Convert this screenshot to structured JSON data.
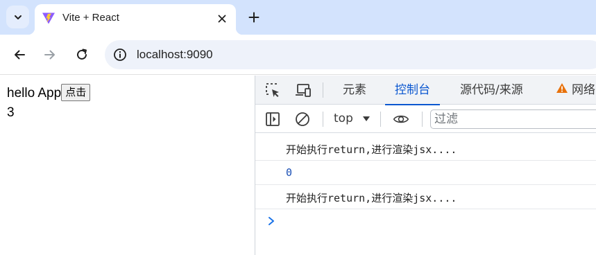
{
  "browser": {
    "tab": {
      "title": "Vite + React"
    },
    "address": {
      "url": "localhost:9090"
    }
  },
  "page": {
    "heading": "hello App",
    "button_label": "点击",
    "count": "3"
  },
  "devtools": {
    "tabs": [
      {
        "label": "元素"
      },
      {
        "label": "控制台",
        "active": true
      },
      {
        "label": "源代码/来源"
      },
      {
        "label": "网络"
      }
    ],
    "context": "top",
    "filter_placeholder": "过滤",
    "logs": [
      {
        "text": "开始执行return,进行渲染jsx...."
      },
      {
        "text": "0"
      },
      {
        "text": "开始执行return,进行渲染jsx...."
      }
    ]
  },
  "colors": {
    "accent": "#0b57d0",
    "tabstrip": "#d3e3fd",
    "warning": "#e8710a",
    "vite_purple": "#8c5cff",
    "vite_yellow": "#ffcb2f"
  }
}
